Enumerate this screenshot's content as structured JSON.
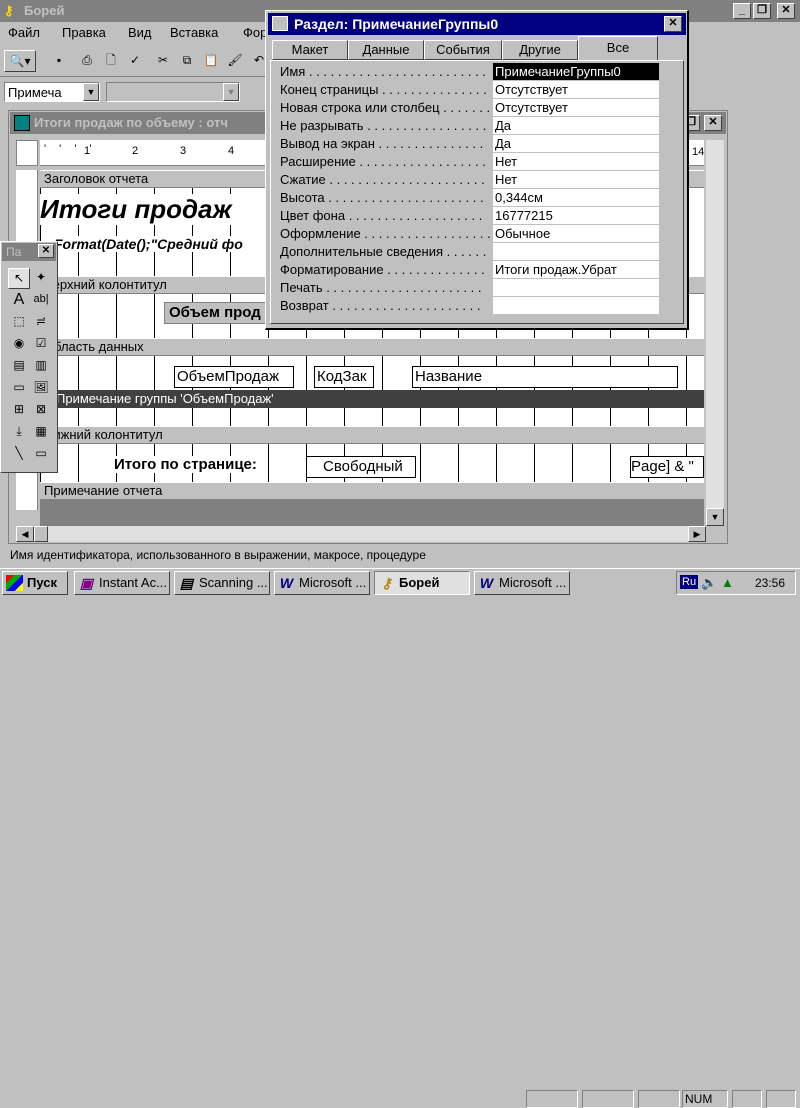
{
  "app": {
    "title": "Борей"
  },
  "menu": [
    "Файл",
    "Правка",
    "Вид",
    "Вставка",
    "Фор"
  ],
  "toolbar2": {
    "object_combo": "Примеча",
    "font_combo": ""
  },
  "report_window": {
    "title": "Итоги продаж по объему : отч"
  },
  "ruler": {
    "ticks": [
      "1",
      "2",
      "3",
      "4"
    ],
    "right_number": "14"
  },
  "sections": {
    "report_header": "Заголовок отчета",
    "page_header": "Верхний колонтитул",
    "detail": "Область данных",
    "group_footer": "Примечание группы 'ОбъемПродаж'",
    "page_footer": "Нижний колонтитул",
    "report_footer": "Примечание отчета"
  },
  "report_controls": {
    "title_text": "Итоги продаж",
    "format_text": "Format(Date();\"Средний фо",
    "page_header_label": "Объем прод",
    "field1": "ОбъемПродаж",
    "field2": "КодЗак",
    "field3": "Название",
    "total_label": "Итого по странице:",
    "total_field": "Свободный",
    "page_expr": "Page] & \""
  },
  "toolbox": {
    "title": "Па"
  },
  "properties": {
    "title": "Раздел: ПримечаниеГруппы0",
    "tabs": [
      "Макет",
      "Данные",
      "События",
      "Другие",
      "Все"
    ],
    "active_tab": "Все",
    "rows": [
      {
        "label": "Имя . . . . . . . . . . . . . . . . . . . . . . . . . . .",
        "value": "ПримечаниеГруппы0"
      },
      {
        "label": "Конец страницы . . . . . . . . . . . . . . .",
        "value": "Отсутствует"
      },
      {
        "label": "Новая строка или столбец . . . . . . .",
        "value": "Отсутствует"
      },
      {
        "label": "Не разрывать . . . . . . . . . . . . . . . . .",
        "value": "Да"
      },
      {
        "label": "Вывод на экран . . . . . . . . . . . . . . .",
        "value": "Да"
      },
      {
        "label": "Расширение . . . . . . . . . . . . . . . . . .",
        "value": "Нет"
      },
      {
        "label": "Сжатие . . . . . . . . . . . . . . . . . . . . . .",
        "value": "Нет"
      },
      {
        "label": "Высота . . . . . . . . . . . . . . . . . . . . . .",
        "value": "0,344см"
      },
      {
        "label": "Цвет фона . . . . . . . . . . . . . . . . . . .",
        "value": "16777215"
      },
      {
        "label": "Оформление . . . . . . . . . . . . . . . . . .",
        "value": "Обычное"
      },
      {
        "label": "Дополнительные сведения . . . . . . .",
        "value": ""
      },
      {
        "label": "Форматирование . . . . . . . . . . . . . .",
        "value": "Итоги продаж.Убрат"
      },
      {
        "label": "Печать . . . . . . . . . . . . . . . . . . . . . .",
        "value": ""
      },
      {
        "label": "Возврат . . . . . . . . . . . . . . . . . . . . .",
        "value": ""
      }
    ]
  },
  "status": {
    "text": "Имя идентификатора, использованного в выражении, макросе, процедуре",
    "num": "NUM"
  },
  "taskbar": {
    "start": "Пуск",
    "buttons": [
      "Instant Ac...",
      "Scanning ...",
      "Microsoft ...",
      "Борей",
      "Microsoft ..."
    ],
    "lang": "Ru",
    "clock": "23:56"
  },
  "icons": {
    "app": "access-key-icon",
    "minimize": "minimize-icon",
    "restore": "restore-icon",
    "close": "close-icon"
  },
  "colors": {
    "titlebar": "#000080",
    "face": "#c0c0c0",
    "group_footer_bar": "#404040"
  }
}
